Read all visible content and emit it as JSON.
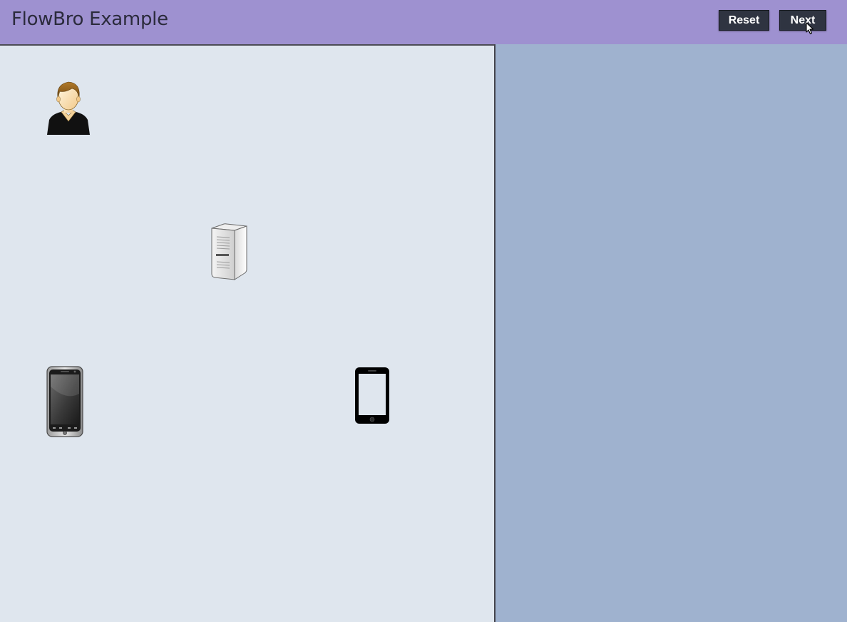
{
  "header": {
    "title": "FlowBro Example",
    "background_color": "#9e91d0"
  },
  "toolbar": {
    "reset_label": "Reset",
    "next_label": "Next"
  },
  "canvas": {
    "background_color": "#dfe6ee",
    "nodes": [
      {
        "name": "user-node",
        "icon": "user-icon"
      },
      {
        "name": "server-node",
        "icon": "server-icon"
      },
      {
        "name": "smartphone-node",
        "icon": "smartphone-icon"
      },
      {
        "name": "mobile-outline-node",
        "icon": "mobile-outline-icon"
      }
    ]
  },
  "side_panel": {
    "background_color": "#9fb2cf"
  }
}
